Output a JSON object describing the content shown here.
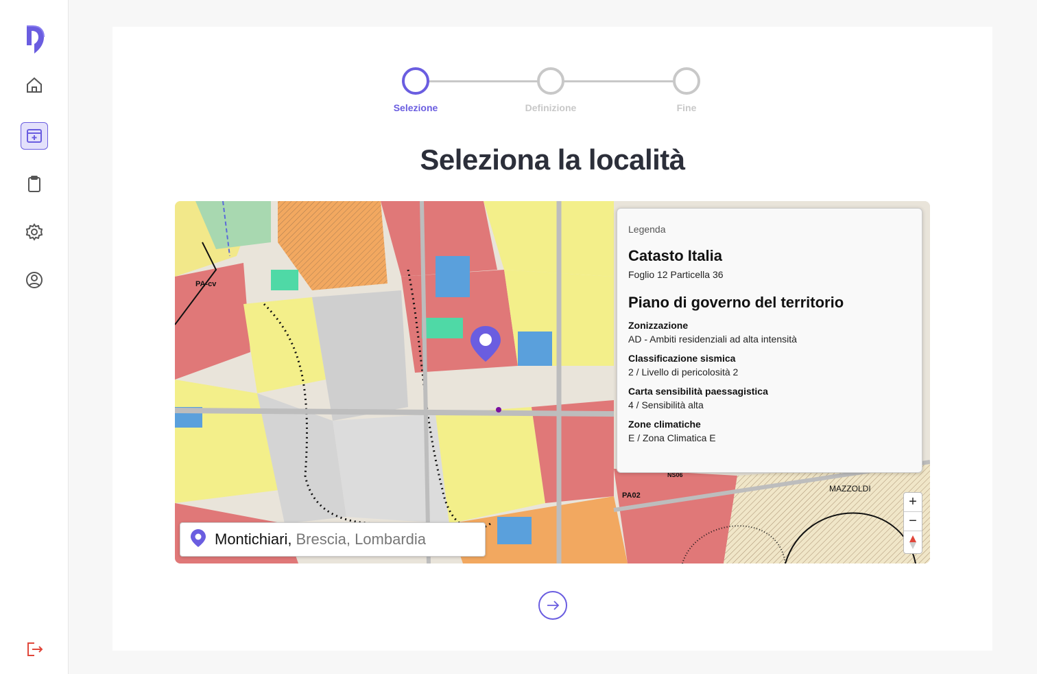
{
  "sidebar": {
    "logo": "logo-icon",
    "items": [
      {
        "icon": "home-icon"
      },
      {
        "icon": "new-project-icon",
        "active": true
      },
      {
        "icon": "clipboard-icon"
      },
      {
        "icon": "gear-icon"
      },
      {
        "icon": "user-circle-icon"
      }
    ],
    "logout": "logout-icon"
  },
  "stepper": {
    "steps": [
      {
        "label": "Selezione",
        "active": true
      },
      {
        "label": "Definizione",
        "active": false
      },
      {
        "label": "Fine",
        "active": false
      }
    ]
  },
  "page": {
    "title": "Seleziona la località"
  },
  "map": {
    "labels": {
      "pa_cv": "PA-cv",
      "pa02": "PA02",
      "ns06": "NS06",
      "mazzoldi": "MAZZOLDI"
    },
    "zoom_in": "+",
    "zoom_out": "−",
    "search": {
      "city": "Montichiari,",
      "rest": "Brescia, Lombardia"
    }
  },
  "legend": {
    "header": "Legenda",
    "cadastre_title": "Catasto Italia",
    "cadastre_value": "Foglio 12 Particella 36",
    "pgt_title": "Piano di governo del territorio",
    "items": [
      {
        "title": "Zonizzazione",
        "value": "AD - Ambiti residenziali ad alta intensità"
      },
      {
        "title": "Classificazione sismica",
        "value": "2 / Livello di pericolosità 2"
      },
      {
        "title": "Carta sensibilità paessagistica",
        "value": "4 / Sensibilità alta"
      },
      {
        "title": "Zone climatiche",
        "value": "E / Zona Climatica E"
      }
    ]
  },
  "colors": {
    "accent": "#6a5de0",
    "logout": "#e0463a"
  }
}
